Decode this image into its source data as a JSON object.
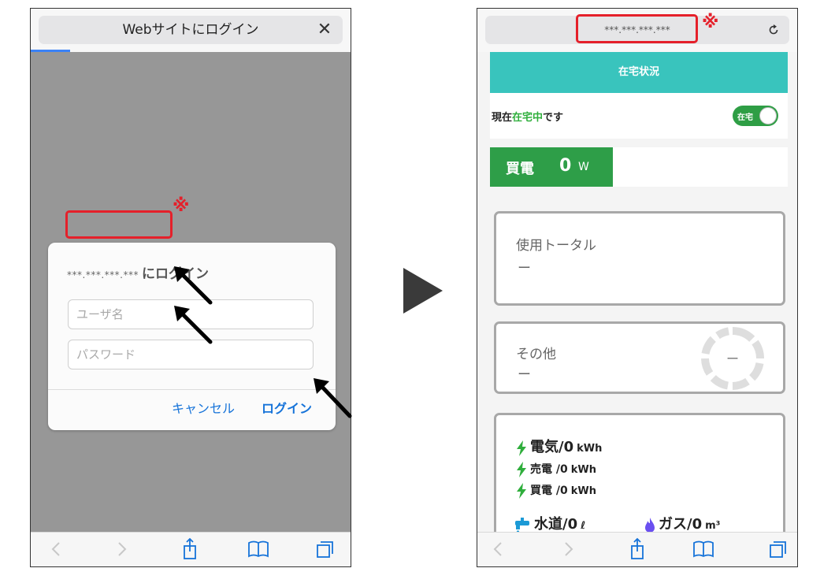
{
  "left_screen": {
    "address_title": "Webサイトにログイン",
    "close_glyph": "✕",
    "dialog": {
      "masked_address": "***.***.***.***",
      "title_suffix": "にログイン",
      "username_placeholder": "ユーザ名",
      "password_placeholder": "パスワード",
      "cancel_label": "キャンセル",
      "login_label": "ログイン"
    },
    "note_mark": "※"
  },
  "right_screen": {
    "masked_address": "***.***.***.***",
    "note_mark": "※",
    "header_title": "在宅状況",
    "status": {
      "prefix": "現在",
      "highlight": "在宅中",
      "suffix": "です",
      "toggle_label": "在宅",
      "toggle_on": true
    },
    "buy": {
      "label": "買電",
      "value": "0",
      "unit": "W"
    },
    "total": {
      "title": "使用トータル",
      "value": "ー"
    },
    "other": {
      "title": "その他",
      "value": "ー",
      "gauge_value": "ー"
    },
    "usage": {
      "electricity": {
        "label": "電気/",
        "value": "0",
        "unit": "kWh"
      },
      "sell": {
        "label": "売電 /",
        "value": "0",
        "unit": "kWh"
      },
      "buy": {
        "label": "買電 /",
        "value": "0",
        "unit": "kWh"
      },
      "water": {
        "label": "水道/",
        "value": "0",
        "unit": "ℓ"
      },
      "gas": {
        "label": "ガス/",
        "value": "0",
        "unit": "m³"
      }
    }
  },
  "colors": {
    "teal": "#39c4bd",
    "green": "#2e9e48",
    "link_blue": "#1673d9",
    "annotation_red": "#e5202a",
    "gas_purple": "#6a4ff0",
    "water_blue": "#1c9ad6"
  }
}
